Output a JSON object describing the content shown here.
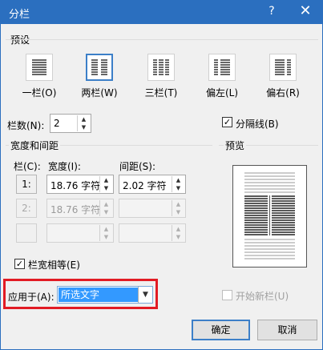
{
  "dialog": {
    "title": "分栏",
    "help_icon": "?",
    "close_icon": "✕"
  },
  "presets": {
    "group_label": "预设",
    "items": [
      {
        "label": "一栏(O)",
        "selected": false
      },
      {
        "label": "两栏(W)",
        "selected": true
      },
      {
        "label": "三栏(T)",
        "selected": false
      },
      {
        "label": "偏左(L)",
        "selected": false
      },
      {
        "label": "偏右(R)",
        "selected": false
      }
    ]
  },
  "num_cols": {
    "label": "栏数(N):",
    "value": "2"
  },
  "line_between": {
    "label": "分隔线(B)",
    "checked": true
  },
  "width_spacing": {
    "group_label": "宽度和间距",
    "col_header": "栏(C):",
    "width_header": "宽度(I):",
    "spacing_header": "间距(S):",
    "rows": [
      {
        "col": "1:",
        "width": "18.76 字符",
        "spacing": "2.02 字符",
        "enabled": true
      },
      {
        "col": "2:",
        "width": "18.76 字符",
        "spacing": "",
        "enabled": false
      },
      {
        "col": "",
        "width": "",
        "spacing": "",
        "enabled": false
      }
    ]
  },
  "equal_width": {
    "label": "栏宽相等(E)",
    "checked": true
  },
  "preview": {
    "label": "预览"
  },
  "apply_to": {
    "label": "应用于(A):",
    "value": "所选文字"
  },
  "start_new_col": {
    "label": "开始新栏(U)",
    "checked": false
  },
  "buttons": {
    "ok": "确定",
    "cancel": "取消"
  },
  "colors": {
    "accent": "#2b6fbf",
    "highlight": "#e21b24",
    "selection": "#3399ff"
  }
}
